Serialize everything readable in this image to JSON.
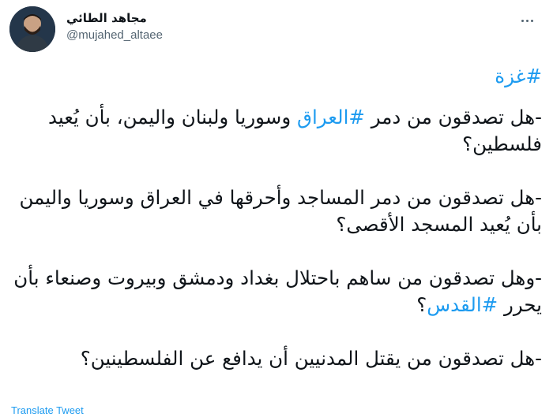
{
  "author": {
    "display_name": "مجاهد الطائي",
    "handle": "@mujahed_altaee"
  },
  "icons": {
    "avatar": "profile-photo",
    "more": "more-horizontal-icon"
  },
  "colors": {
    "link": "#1d9bf0",
    "text": "#0f1419",
    "secondary": "#536471"
  },
  "tweet": {
    "hashtag_line": "#غزة",
    "p1": {
      "prefix": "-هل تصدقون من دمر ",
      "hashtag": "#العراق",
      "suffix": " وسوريا ولبنان واليمن، بأن يُعيد فلسطين؟"
    },
    "p2": "-هل تصدقون من دمر المساجد وأحرقها في العراق وسوريا واليمن بأن يُعيد المسجد الأقصى؟",
    "p3": {
      "prefix": "-وهل تصدقون من ساهم باحتلال بغداد ودمشق وبيروت وصنعاء بأن يحرر ",
      "hashtag": "#القدس",
      "suffix": "؟"
    },
    "p4": "-هل تصدقون من يقتل المدنيين أن يدافع عن الفلسطينين؟"
  },
  "translate_label": "Translate Tweet"
}
